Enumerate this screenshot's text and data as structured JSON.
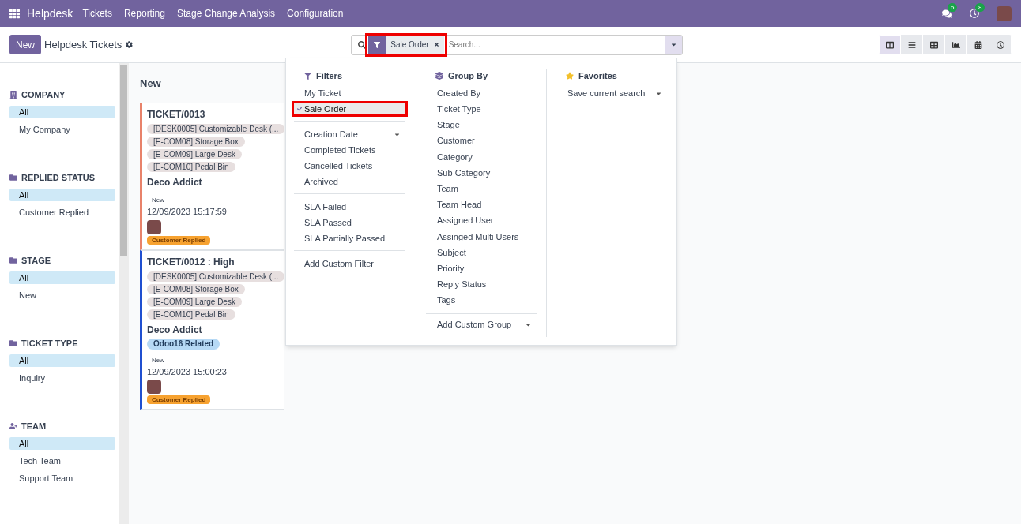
{
  "navbar": {
    "app_name": "Helpdesk",
    "menu": [
      "Tickets",
      "Reporting",
      "Stage Change Analysis",
      "Configuration"
    ],
    "messages_count": "5",
    "activities_count": "8"
  },
  "control_panel": {
    "new_button": "New",
    "title": "Helpdesk Tickets",
    "search": {
      "facets": [
        {
          "label": "Sale Order",
          "highlighted": true
        }
      ],
      "placeholder": "Search..."
    },
    "views": [
      {
        "kind": "kanban",
        "selected": true
      },
      {
        "kind": "list",
        "selected": false
      },
      {
        "kind": "pivot",
        "selected": false
      },
      {
        "kind": "graph",
        "selected": false
      },
      {
        "kind": "calendar",
        "selected": false
      },
      {
        "kind": "activity",
        "selected": false
      }
    ]
  },
  "sidebar": {
    "sections": [
      {
        "title": "COMPANY",
        "kind": "building",
        "items": [
          {
            "label": "All",
            "selected": true
          },
          {
            "label": "My Company",
            "selected": false
          }
        ]
      },
      {
        "title": "REPLIED STATUS",
        "kind": "folder",
        "items": [
          {
            "label": "All",
            "selected": true
          },
          {
            "label": "Customer Replied",
            "selected": false
          }
        ]
      },
      {
        "title": "STAGE",
        "kind": "folder",
        "items": [
          {
            "label": "All",
            "selected": true
          },
          {
            "label": "New",
            "selected": false
          }
        ]
      },
      {
        "title": "TICKET TYPE",
        "kind": "folder",
        "items": [
          {
            "label": "All",
            "selected": true
          },
          {
            "label": "Inquiry",
            "selected": false
          }
        ]
      },
      {
        "title": "TEAM",
        "kind": "team",
        "items": [
          {
            "label": "All",
            "selected": true
          },
          {
            "label": "Tech Team",
            "selected": false
          },
          {
            "label": "Support Team",
            "selected": false
          }
        ]
      }
    ]
  },
  "kanban": {
    "column_title": "New",
    "cards": [
      {
        "title": "TICKET/0013",
        "color": "#e8826a",
        "products": [
          "[DESK0005] Customizable Desk (...",
          "[E-COM08] Storage Box",
          "[E-COM09] Large Desk",
          "[E-COM10] Pedal Bin"
        ],
        "customer": "Deco Addict",
        "stage": "New",
        "date": "12/09/2023 15:17:59",
        "status": "Customer Replied"
      },
      {
        "title": "TICKET/0012 : High",
        "color": "#1f4fd0",
        "products": [
          "[DESK0005] Customizable Desk (...",
          "[E-COM08] Storage Box",
          "[E-COM09] Large Desk",
          "[E-COM10] Pedal Bin"
        ],
        "customer": "Deco Addict",
        "tags": [
          "Odoo16 Related"
        ],
        "stage": "New",
        "date": "12/09/2023 15:00:23",
        "status": "Customer Replied"
      }
    ]
  },
  "search_panel": {
    "filters": {
      "title": "Filters",
      "groups": [
        [
          {
            "label": "My Ticket",
            "selected": false,
            "highlighted": false,
            "has_options": false
          },
          {
            "label": "Sale Order",
            "selected": true,
            "highlighted": true,
            "has_options": false
          }
        ],
        [
          {
            "label": "Creation Date",
            "selected": false,
            "highlighted": false,
            "has_options": true
          },
          {
            "label": "Completed Tickets",
            "selected": false,
            "highlighted": false,
            "has_options": false
          },
          {
            "label": "Cancelled Tickets",
            "selected": false,
            "highlighted": false,
            "has_options": false
          },
          {
            "label": "Archived",
            "selected": false,
            "highlighted": false,
            "has_options": false
          }
        ],
        [
          {
            "label": "SLA Failed",
            "selected": false,
            "highlighted": false,
            "has_options": false
          },
          {
            "label": "SLA Passed",
            "selected": false,
            "highlighted": false,
            "has_options": false
          },
          {
            "label": "SLA Partially Passed",
            "selected": false,
            "highlighted": false,
            "has_options": false
          }
        ],
        [
          {
            "label": "Add Custom Filter",
            "selected": false,
            "highlighted": false,
            "has_options": false
          }
        ]
      ]
    },
    "group_by": {
      "title": "Group By",
      "items": [
        "Created By",
        "Ticket Type",
        "Stage",
        "Customer",
        "Category",
        "Sub Category",
        "Team",
        "Team Head",
        "Assigned User",
        "Assinged Multi Users",
        "Subject",
        "Priority",
        "Reply Status",
        "Tags"
      ],
      "custom_label": "Add Custom Group"
    },
    "favorites": {
      "title": "Favorites",
      "save_label": "Save current search"
    }
  }
}
